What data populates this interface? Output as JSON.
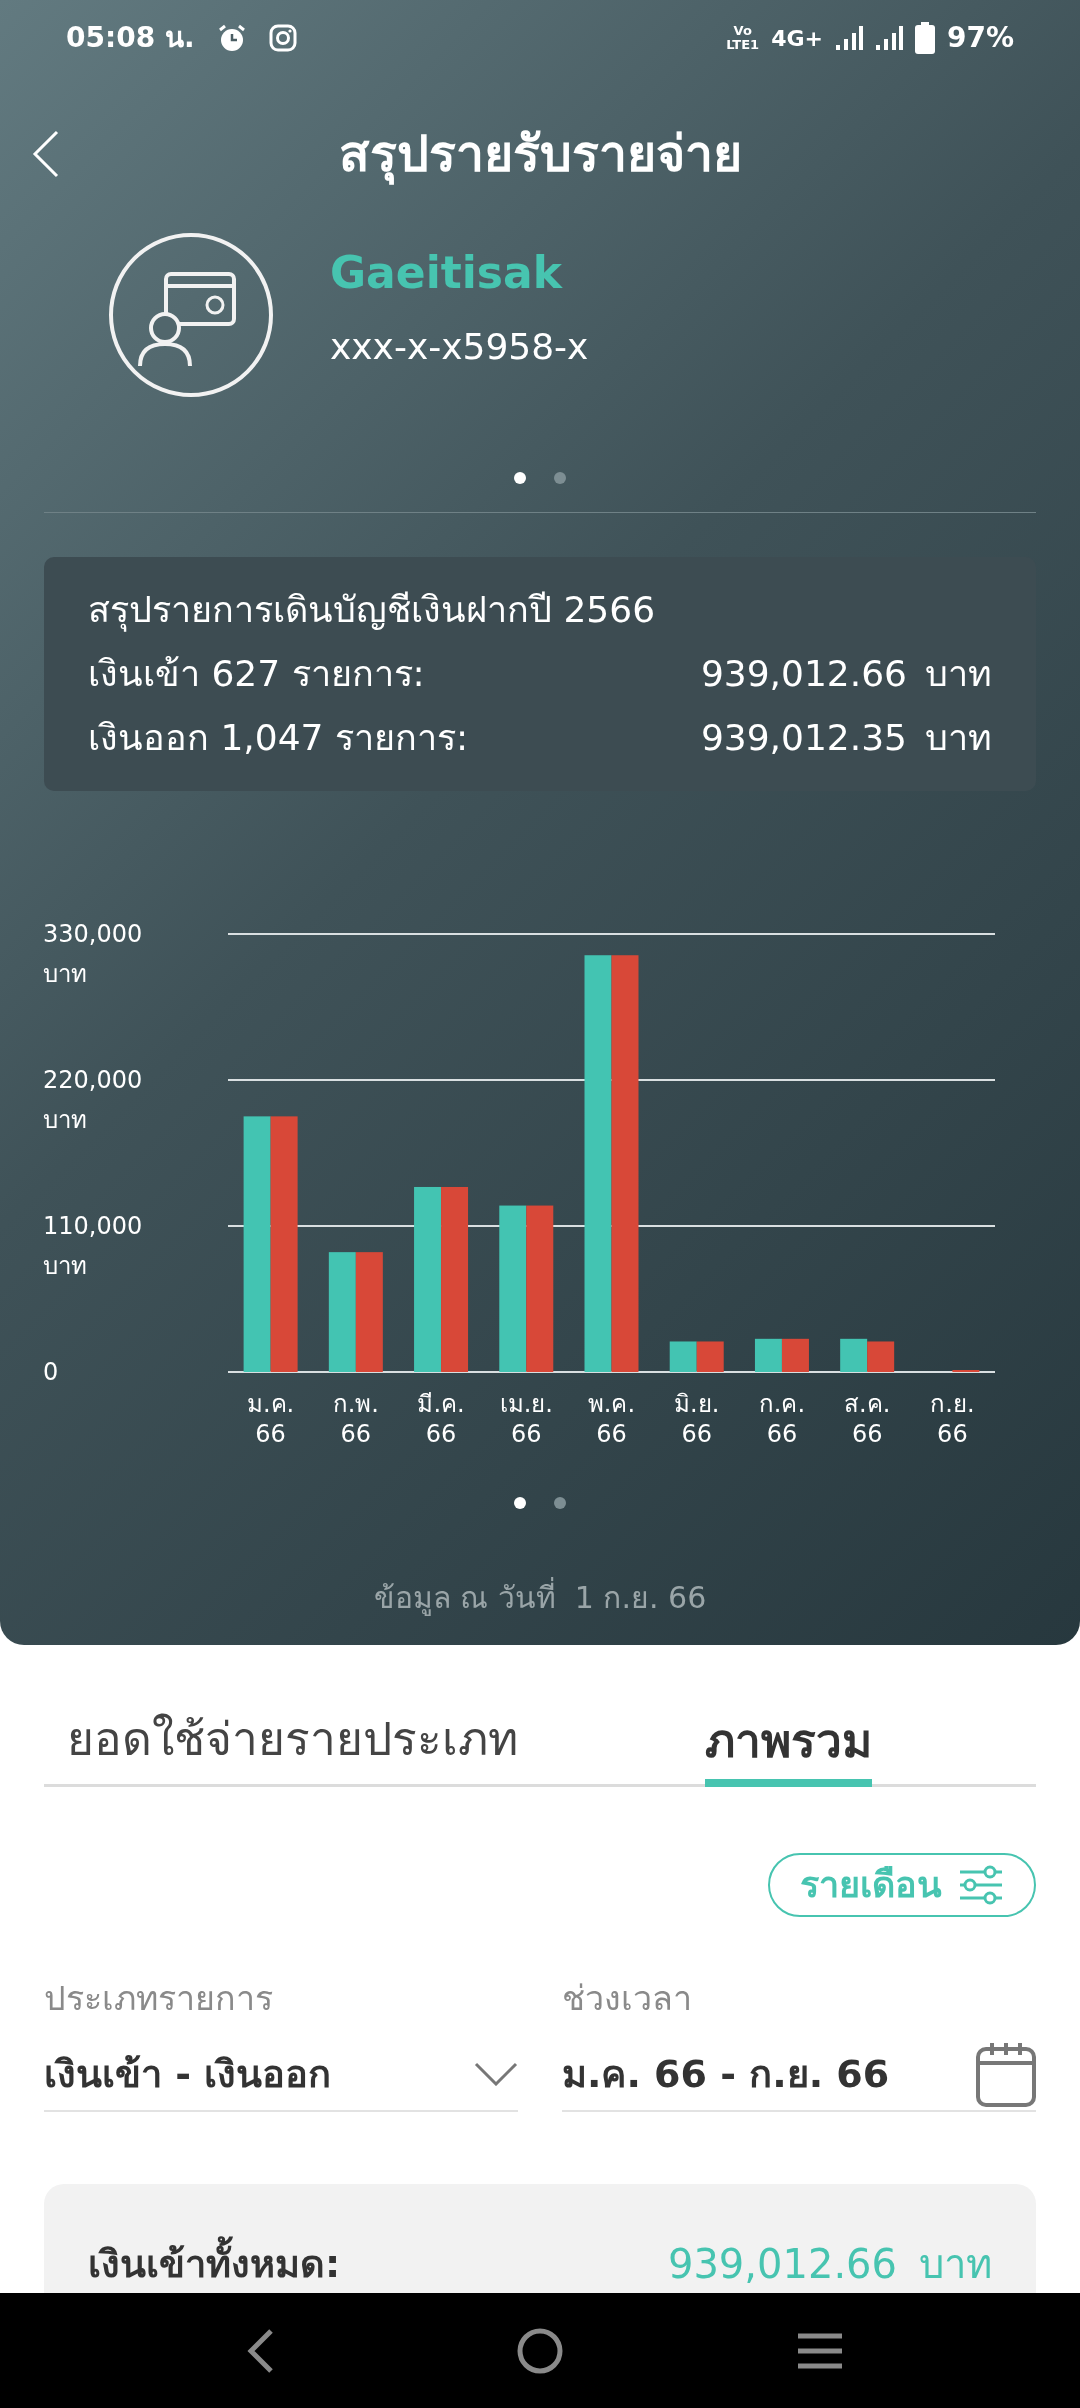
{
  "status_bar": {
    "time": "05:08 น.",
    "network_badge": [
      "Vo",
      "LTE1"
    ],
    "network": "4G+",
    "battery": "97%"
  },
  "header": {
    "title": "สรุปรายรับรายจ่าย"
  },
  "account": {
    "name": "Gaeitisak",
    "number": "xxx-x-x5958-x"
  },
  "account_pager": [
    {
      "selected": true
    },
    {
      "selected": false
    }
  ],
  "summary": {
    "title": "สรุปรายการเดินบัญชีเงินฝากปี 2566",
    "rows": [
      {
        "label": "เงินเข้า 627 รายการ:",
        "amount": "939,012.66",
        "unit": "บาท"
      },
      {
        "label": "เงินออก 1,047 รายการ:",
        "amount": "939,012.35",
        "unit": "บาท"
      }
    ]
  },
  "chart": {
    "chart_data": {
      "type": "bar",
      "categories": [
        "ม.ค. 66",
        "ก.พ. 66",
        "มี.ค. 66",
        "เม.ย. 66",
        "พ.ค. 66",
        "มิ.ย. 66",
        "ก.ค. 66",
        "ส.ค. 66",
        "ก.ย. 66"
      ],
      "series": [
        {
          "color": "#43c4b2",
          "values": [
            192600,
            90300,
            139400,
            125400,
            314000,
            23000,
            25000,
            25000,
            0
          ]
        },
        {
          "color": "#d84838",
          "values": [
            192600,
            90300,
            139400,
            125400,
            314000,
            23000,
            25000,
            23000,
            1500
          ]
        }
      ],
      "ylim": [
        0,
        330000
      ],
      "yticks": [
        {
          "value": 0,
          "label": "0"
        },
        {
          "value": 110000,
          "label": "110,000 บาท"
        },
        {
          "value": 220000,
          "label": "220,000 บาท"
        },
        {
          "value": 330000,
          "label": "330,000 บาท"
        }
      ]
    }
  },
  "chart_pager": [
    {
      "selected": true
    },
    {
      "selected": false
    }
  ],
  "data_date": "ข้อมูล ณ วันที่  1 ก.ย. 66",
  "tabs": [
    {
      "label": "ยอดใช้จ่ายรายประเภท",
      "selected": false
    },
    {
      "label": "ภาพรวม",
      "selected": true
    }
  ],
  "period_button": "รายเดือน",
  "filters": [
    {
      "kind": "dropdown",
      "label": "ประเภทรายการ",
      "value": "เงินเข้า - เงินออก"
    },
    {
      "kind": "date",
      "label": "ช่วงเวลา",
      "value": "ม.ค. 66 - ก.ย. 66"
    }
  ],
  "totals": [
    {
      "label": "เงินเข้าทั้งหมด:",
      "amount": "939,012.66",
      "unit": "บาท"
    }
  ]
}
